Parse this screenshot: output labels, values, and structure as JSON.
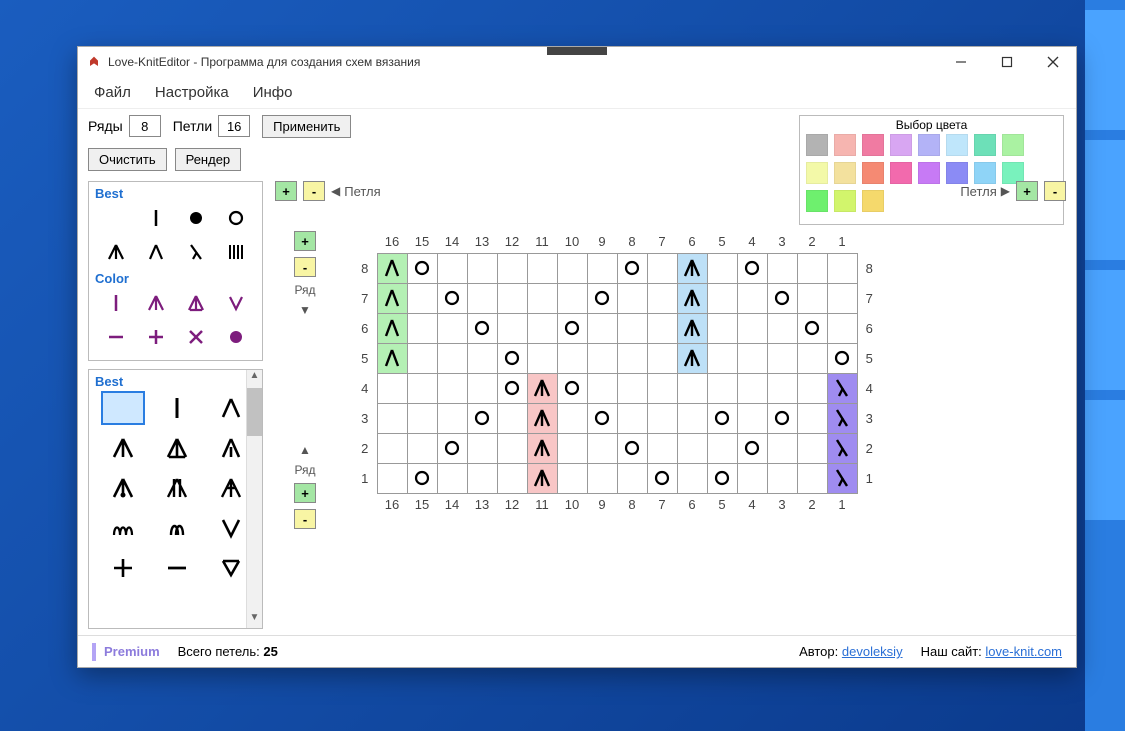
{
  "window": {
    "title": "Love-KnitEditor - Программа для создания схем вязания"
  },
  "menu": {
    "file": "Файл",
    "settings": "Настройка",
    "info": "Инфо"
  },
  "toolbar": {
    "rows_label": "Ряды",
    "rows_value": "8",
    "stitches_label": "Петли",
    "stitches_value": "16",
    "apply": "Применить",
    "clear": "Очистить",
    "render": "Рендер"
  },
  "color_picker": {
    "title": "Выбор цвета",
    "rows": [
      [
        "#b3b3b3",
        "#f6b5b0",
        "#f07ba2",
        "#d8a6f2",
        "#b3b3f7",
        "#bfe6fb",
        "#6de0b8",
        "#aaf2a2"
      ],
      [
        "#f3f9a8",
        "#f3e19e",
        "#f58a73",
        "#f26aad",
        "#c77af5",
        "#8b8bf5",
        "#8fd4f7",
        "#79f2bd"
      ],
      [
        "#6ef06e",
        "#d2f56c",
        "#f5d96c"
      ]
    ]
  },
  "palette_top": {
    "title_best": "Best",
    "title_color": "Color"
  },
  "palette_bottom": {
    "title": "Best"
  },
  "loop": {
    "left_label": "Петля",
    "right_label": "Петля"
  },
  "row_ctrl": {
    "label": "Ряд"
  },
  "grid": {
    "cols": 16,
    "rows": 8,
    "col_headers": [
      16,
      15,
      14,
      13,
      12,
      11,
      10,
      9,
      8,
      7,
      6,
      5,
      4,
      3,
      2,
      1
    ],
    "row_headers": [
      8,
      7,
      6,
      5,
      4,
      3,
      2,
      1
    ],
    "cells": {
      "r8": {
        "c16": {
          "sym": "dec-left",
          "bg": "green"
        },
        "c15": {
          "sym": "yo"
        },
        "c8": {
          "sym": "yo"
        },
        "c6": {
          "sym": "cdd",
          "bg": "blue"
        },
        "c4": {
          "sym": "yo"
        }
      },
      "r7": {
        "c16": {
          "sym": "dec-left",
          "bg": "green"
        },
        "c14": {
          "sym": "yo"
        },
        "c9": {
          "sym": "yo"
        },
        "c6": {
          "sym": "cdd",
          "bg": "blue"
        },
        "c3": {
          "sym": "yo"
        }
      },
      "r6": {
        "c16": {
          "sym": "dec-left",
          "bg": "green"
        },
        "c13": {
          "sym": "yo"
        },
        "c10": {
          "sym": "yo"
        },
        "c6": {
          "sym": "cdd",
          "bg": "blue"
        },
        "c2": {
          "sym": "yo"
        }
      },
      "r5": {
        "c16": {
          "sym": "dec-left",
          "bg": "green"
        },
        "c12": {
          "sym": "yo"
        },
        "c6": {
          "sym": "cdd",
          "bg": "blue"
        },
        "c1": {
          "sym": "yo"
        }
      },
      "r4": {
        "c12": {
          "sym": "yo"
        },
        "c11": {
          "sym": "cdd",
          "bg": "pink"
        },
        "c10": {
          "sym": "yo"
        },
        "c1": {
          "sym": "lambda",
          "bg": "purple"
        }
      },
      "r3": {
        "c13": {
          "sym": "yo"
        },
        "c11": {
          "sym": "cdd",
          "bg": "pink"
        },
        "c9": {
          "sym": "yo"
        },
        "c5": {
          "sym": "yo"
        },
        "c3": {
          "sym": "yo"
        },
        "c1": {
          "sym": "lambda",
          "bg": "purple"
        }
      },
      "r2": {
        "c14": {
          "sym": "yo"
        },
        "c11": {
          "sym": "cdd",
          "bg": "pink"
        },
        "c8": {
          "sym": "yo"
        },
        "c4": {
          "sym": "yo"
        },
        "c1": {
          "sym": "lambda",
          "bg": "purple"
        }
      },
      "r1": {
        "c15": {
          "sym": "yo"
        },
        "c11": {
          "sym": "cdd",
          "bg": "pink"
        },
        "c7": {
          "sym": "yo"
        },
        "c5": {
          "sym": "yo"
        },
        "c1": {
          "sym": "lambda",
          "bg": "purple"
        }
      }
    }
  },
  "status": {
    "premium": "Premium",
    "total_label": "Всего петель:",
    "total_value": "25",
    "author_label": "Автор:",
    "author_link": "devoleksiy",
    "site_label": "Наш сайт:",
    "site_link": "love-knit.com"
  }
}
